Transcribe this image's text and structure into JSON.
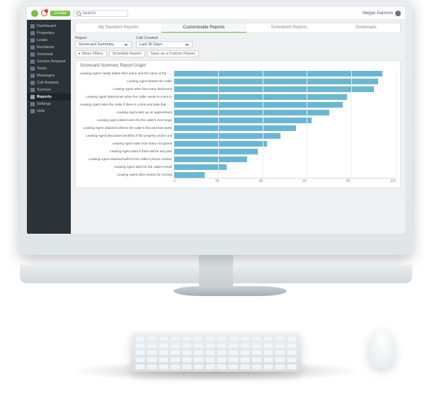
{
  "header": {
    "create_label": "Create",
    "search_placeholder": "Search",
    "user_name": "Megan Garrison"
  },
  "sidebar": {
    "items": [
      {
        "label": "Dashboard",
        "name": "dashboard"
      },
      {
        "label": "Properties",
        "name": "properties"
      },
      {
        "label": "Leads",
        "name": "leads"
      },
      {
        "label": "Residents",
        "name": "residents"
      },
      {
        "label": "Schedule",
        "name": "schedule"
      },
      {
        "label": "Service Request",
        "name": "service-request"
      },
      {
        "label": "Tasks",
        "name": "tasks"
      },
      {
        "label": "Messages",
        "name": "messages"
      },
      {
        "label": "Call Analysis",
        "name": "call-analysis"
      },
      {
        "label": "Surveys",
        "name": "surveys"
      },
      {
        "label": "Reports",
        "name": "reports"
      },
      {
        "label": "Settings",
        "name": "settings"
      },
      {
        "label": "Help",
        "name": "help"
      }
    ],
    "active": 10
  },
  "tabs": {
    "items": [
      "My Standard Reports",
      "Customizable Reports",
      "Scheduled Reports",
      "Downloads"
    ],
    "active": 1
  },
  "config": {
    "report_label": "Report",
    "report_select": "Scorecard Summary",
    "call_created_label": "Call Created",
    "call_created_select": "Last 30 Days"
  },
  "buttons": {
    "show_filters": "▸ Show Filters",
    "schedule_report": "Schedule Report",
    "save_as_custom": "Save as a Custom Report"
  },
  "chart_title": "Scorecard Summary Report Graph",
  "chart_data": {
    "type": "bar",
    "orientation": "horizontal",
    "xlabel": "",
    "ylabel": "",
    "xlim": [
      0,
      100
    ],
    "ticks": [
      0,
      20,
      40,
      60,
      80,
      100
    ],
    "categories": [
      "Leasing Agent clearly states their name and the name of the property",
      "Leasing Agent thanks the caller",
      "Leasing Agent asks how many bedrooms",
      "Leasing Agent determines when the caller needs to move in",
      "Leasing Agent asks the caller if there is a time and date that would work to come by the property",
      "Leasing Agent sets up an appointment",
      "Leasing Agent determines the the caller's rent range",
      "Leasing Agent obtains/confirms the caller's first and last name",
      "Leasing Agent discusses benefits of the property and/or unit",
      "Leasing Agent asks how many occupants",
      "Leasing Agent asks if there will be any pets",
      "Leasing Agent obtains/confirms the caller's phone number",
      "Leasing Agent asks for the caller's email",
      "Leasing Agent asks reason for moving"
    ],
    "values": [
      94,
      92,
      90,
      78,
      76,
      70,
      62,
      55,
      48,
      42,
      38,
      33,
      24,
      14
    ],
    "bar_color": "#6bb7d1"
  }
}
